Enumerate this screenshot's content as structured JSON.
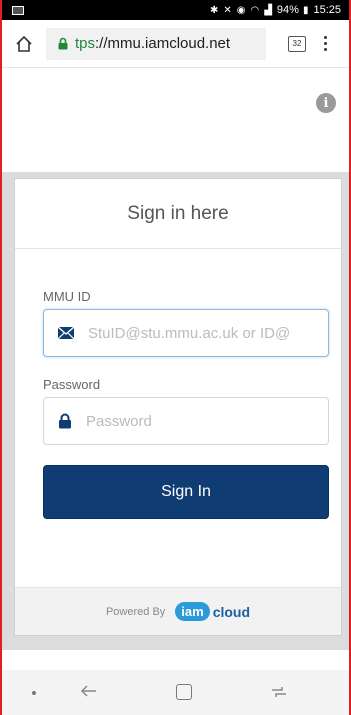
{
  "status_bar": {
    "battery": "94%",
    "time": "15:25"
  },
  "browser": {
    "url_prefix": "tps",
    "url_rest": "://mmu.iamcloud.net",
    "tab_count": "32"
  },
  "form": {
    "title": "Sign in here",
    "id_label": "MMU ID",
    "id_placeholder": "StuID@stu.mmu.ac.uk or ID@",
    "password_label": "Password",
    "password_placeholder": "Password",
    "signin_label": "Sign In"
  },
  "footer": {
    "powered_by": "Powered By",
    "logo_iam": "iam",
    "logo_cloud": "cloud"
  },
  "colors": {
    "primary_button": "#0e3c73",
    "brand_light": "#2a9ad8",
    "brand_dark": "#1d5fa0",
    "secure_lock": "#1d8a3a"
  }
}
